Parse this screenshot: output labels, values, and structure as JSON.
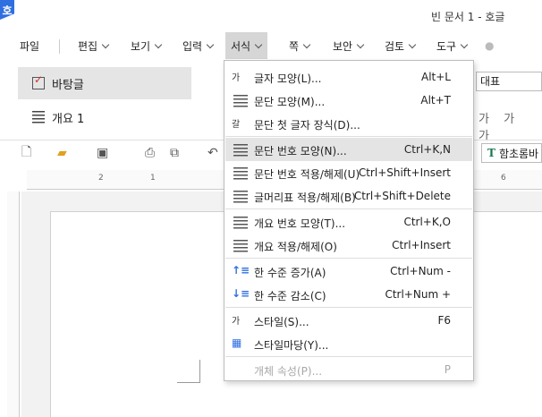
{
  "app": {
    "logo_char": "호",
    "title": "빈 문서 1 - 호글"
  },
  "menubar": {
    "items": [
      "파일",
      "편집",
      "보기",
      "입력",
      "서식",
      "쪽",
      "보안",
      "검토",
      "도구"
    ],
    "active": "서식"
  },
  "style_panel": {
    "items": [
      "바탕글",
      "개요 1"
    ]
  },
  "right_panel": {
    "style_box": "대표",
    "format_letters": "가 가 가",
    "font_box": "함초롬바"
  },
  "dropdown": {
    "items": [
      {
        "label": "글자 모양(L)...",
        "shortcut": "Alt+L",
        "icon": "char-shape-icon"
      },
      {
        "label": "문단 모양(M)...",
        "shortcut": "Alt+T",
        "icon": "para-shape-icon"
      },
      {
        "label": "문단 첫 글자 장식(D)...",
        "shortcut": "",
        "icon": "drop-cap-icon"
      },
      {
        "label": "문단 번호 모양(N)...",
        "shortcut": "Ctrl+K,N",
        "icon": "para-number-icon"
      },
      {
        "label": "문단 번호 적용/해제(U)",
        "shortcut": "Ctrl+Shift+Insert",
        "icon": "para-number-toggle-icon"
      },
      {
        "label": "글머리표 적용/해제(B)",
        "shortcut": "Ctrl+Shift+Delete",
        "icon": "bullet-icon"
      },
      {
        "label": "개요 번호 모양(T)...",
        "shortcut": "Ctrl+K,O",
        "icon": "outline-number-icon"
      },
      {
        "label": "개요 적용/해제(O)",
        "shortcut": "Ctrl+Insert",
        "icon": "outline-toggle-icon"
      },
      {
        "label": "한 수준 증가(A)",
        "shortcut": "Ctrl+Num -",
        "icon": "level-up-icon"
      },
      {
        "label": "한 수준 감소(C)",
        "shortcut": "Ctrl+Num +",
        "icon": "level-down-icon"
      },
      {
        "label": "스타일(S)...",
        "shortcut": "F6",
        "icon": "style-icon"
      },
      {
        "label": "스타일마당(Y)...",
        "shortcut": "",
        "icon": "style-gallery-icon"
      },
      {
        "label": "개체 속성(P)...",
        "shortcut": "P",
        "icon": ""
      }
    ]
  },
  "ruler": {
    "labels": [
      "2",
      "1",
      "1",
      "2",
      "6"
    ]
  }
}
